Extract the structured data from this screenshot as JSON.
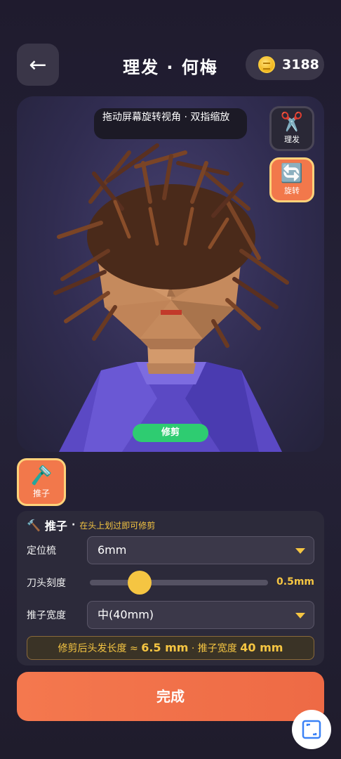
{
  "header": {
    "back_icon": "arrow-left-icon",
    "title": "理发 · 何梅",
    "coin_icon": "coin-icon",
    "coins": "3188"
  },
  "viewport": {
    "hint": "拖动屏幕旋转视角 · 双指缩放",
    "side_tools": [
      {
        "icon": "scissors-icon",
        "label": "理发",
        "active": false
      },
      {
        "icon": "rotate-icon",
        "label": "旋转",
        "active": true
      }
    ],
    "mode_pill": "修剪"
  },
  "tool": {
    "icon": "razor-icon",
    "label": "推子"
  },
  "panel": {
    "name": "推子",
    "separator": "·",
    "tip": "在头上划过即可修剪",
    "guard_label": "定位梳",
    "guard_value": "6mm",
    "blade_label": "刀头刻度",
    "blade_value": "0.5mm",
    "blade_level": 0.28,
    "width_label": "推子宽度",
    "width_value": "中(40mm)",
    "summary_prefix": "修剪后头发长度 ≈ ",
    "summary_length": "6.5 mm",
    "summary_mid": " · 推子宽度 ",
    "summary_width": "40 mm"
  },
  "done_label": "完成",
  "float_icon": "crop-icon",
  "colors": {
    "accent": "#f2784b",
    "highlight": "#f5c542",
    "green": "#2ecc71"
  }
}
